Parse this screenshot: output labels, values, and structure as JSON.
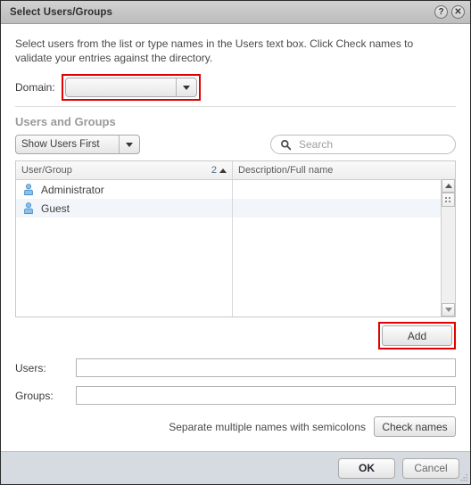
{
  "window": {
    "title": "Select Users/Groups",
    "help_icon": "help-icon",
    "help_glyph": "?",
    "close_icon": "close-icon",
    "close_glyph": "✕"
  },
  "intro": {
    "text": "Select users from the list or type names in the Users text box. Click Check names to validate your entries against the directory."
  },
  "domain": {
    "label": "Domain:",
    "value": "",
    "highlighted": true,
    "highlight_color": "#e20000"
  },
  "section": {
    "title": "Users and Groups"
  },
  "toolbar": {
    "filter_label": "Show Users First",
    "search_placeholder": "Search",
    "search_value": "",
    "search_icon": "search-icon"
  },
  "table": {
    "columns": [
      {
        "label": "User/Group",
        "sort_number": "2",
        "sort_direction": "▲"
      },
      {
        "label": "Description/Full name"
      }
    ],
    "rows": [
      {
        "icon": "user-icon",
        "name": "Administrator",
        "description": ""
      },
      {
        "icon": "user-icon",
        "name": "Guest",
        "description": ""
      }
    ],
    "scrollbar": {
      "up_icon": "scroll-up-arrow-icon",
      "down_icon": "scroll-down-arrow-icon",
      "thumb_icon": "scroll-thumb-grip-icon"
    }
  },
  "actions": {
    "add_label": "Add",
    "add_highlighted": true,
    "add_highlight_color": "#e20000"
  },
  "fields": {
    "users_label": "Users:",
    "users_value": "",
    "users_placeholder": "",
    "groups_label": "Groups:",
    "groups_value": "",
    "groups_placeholder": ""
  },
  "hint": {
    "text": "Separate multiple names with semicolons",
    "check_names_label": "Check names"
  },
  "footer": {
    "ok_label": "OK",
    "cancel_label": "Cancel",
    "resize_icon": "resize-grip-icon"
  }
}
